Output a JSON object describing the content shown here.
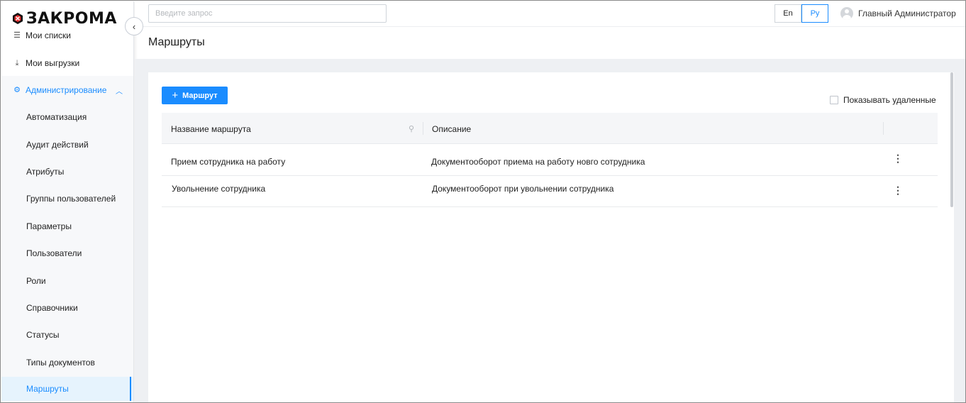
{
  "brand": {
    "name": "ЗАКРОМА"
  },
  "sidebar": {
    "items": [
      {
        "label": "Мои списки",
        "icon": "list-icon"
      },
      {
        "label": "Мои выгрузки",
        "icon": "download-icon"
      },
      {
        "label": "Администрирование",
        "icon": "gear-icon"
      }
    ],
    "admin_sub": [
      {
        "label": "Автоматизация"
      },
      {
        "label": "Аудит действий"
      },
      {
        "label": "Атрибуты"
      },
      {
        "label": "Группы пользователей"
      },
      {
        "label": "Параметры"
      },
      {
        "label": "Пользователи"
      },
      {
        "label": "Роли"
      },
      {
        "label": "Справочники"
      },
      {
        "label": "Статусы"
      },
      {
        "label": "Типы документов"
      },
      {
        "label": "Маршруты"
      }
    ],
    "active": "Маршруты"
  },
  "header": {
    "search_placeholder": "Введите запрос",
    "lang_en": "En",
    "lang_ru": "Ру",
    "selected_lang": "Ру",
    "user_name": "Главный Администратор"
  },
  "page": {
    "title": "Маршруты",
    "add_button": "Маршрут",
    "show_deleted_label": "Показывать удаленные",
    "show_deleted_checked": false
  },
  "table": {
    "columns": [
      "Название маршрута",
      "Описание"
    ],
    "rows": [
      {
        "name": "Прием сотрудника на работу",
        "description": "Документооборот приема на работу новго сотрудника"
      },
      {
        "name": "Увольнение сотрудника",
        "description": "Документооборот при увольнении сотрудника"
      }
    ]
  },
  "colors": {
    "accent": "#1a8cff",
    "content_bg": "#eef0f3",
    "active_bg": "#e6f3fd"
  }
}
